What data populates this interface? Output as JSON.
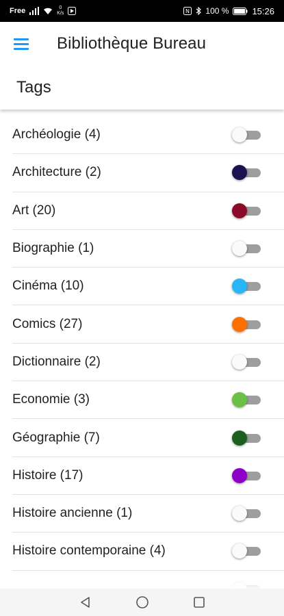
{
  "status_bar": {
    "carrier": "Free",
    "net_speed_value": "0",
    "net_speed_unit": "K/s",
    "battery_percent": "100 %",
    "time": "15:26"
  },
  "app_bar": {
    "title": "Bibliothèque Bureau"
  },
  "section": {
    "title": "Tags"
  },
  "tags": [
    {
      "label": "Archéologie (4)",
      "thumb_color": "#fafafa"
    },
    {
      "label": "Architecture (2)",
      "thumb_color": "#1a1150"
    },
    {
      "label": "Art (20)",
      "thumb_color": "#8b0a2a"
    },
    {
      "label": "Biographie (1)",
      "thumb_color": "#fafafa"
    },
    {
      "label": "Cinéma (10)",
      "thumb_color": "#29b6f6"
    },
    {
      "label": "Comics (27)",
      "thumb_color": "#ff6f00"
    },
    {
      "label": "Dictionnaire (2)",
      "thumb_color": "#fafafa"
    },
    {
      "label": "Economie (3)",
      "thumb_color": "#6abf45"
    },
    {
      "label": "Géographie (7)",
      "thumb_color": "#1b5e20"
    },
    {
      "label": "Histoire (17)",
      "thumb_color": "#8e00c8"
    },
    {
      "label": "Histoire ancienne (1)",
      "thumb_color": "#fafafa"
    },
    {
      "label": "Histoire contemporaine (4)",
      "thumb_color": "#fafafa"
    },
    {
      "label": "",
      "thumb_color": "#fafafa"
    }
  ],
  "icons": {
    "menu": "hamburger-menu-icon",
    "back": "back-triangle-icon",
    "home": "home-circle-icon",
    "recents": "recents-square-icon"
  },
  "colors": {
    "accent": "#2196f3",
    "track_off": "#9e9e9e"
  }
}
